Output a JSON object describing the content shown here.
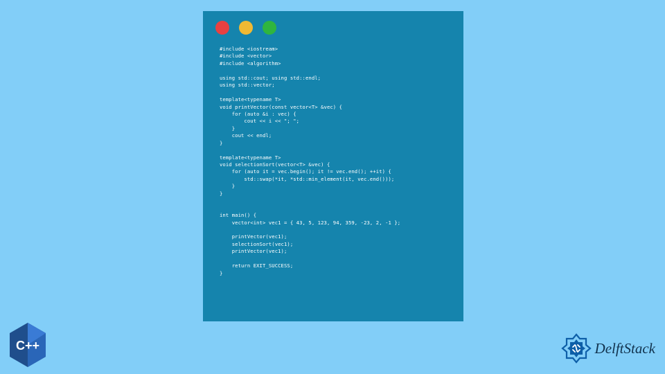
{
  "code_lines": [
    "#include <iostream>",
    "#include <vector>",
    "#include <algorithm>",
    "",
    "using std::cout; using std::endl;",
    "using std::vector;",
    "",
    "template<typename T>",
    "void printVector(const vector<T> &vec) {",
    "    for (auto &i : vec) {",
    "        cout << i << \"; \";",
    "    }",
    "    cout << endl;",
    "}",
    "",
    "template<typename T>",
    "void selectionSort(vector<T> &vec) {",
    "    for (auto it = vec.begin(); it != vec.end(); ++it) {",
    "        std::swap(*it, *std::min_element(it, vec.end()));",
    "    }",
    "}",
    "",
    "",
    "int main() {",
    "    vector<int> vec1 = { 43, 5, 123, 94, 359, -23, 2, -1 };",
    "",
    "    printVector(vec1);",
    "    selectionSort(vec1);",
    "    printVector(vec1);",
    "",
    "    return EXIT_SUCCESS;",
    "}"
  ],
  "cpp_badge_text": "C++",
  "brand_text": "DelftStack",
  "traffic_colors": {
    "red": "#e84141",
    "yellow": "#f0b933",
    "green": "#2fb53f"
  }
}
